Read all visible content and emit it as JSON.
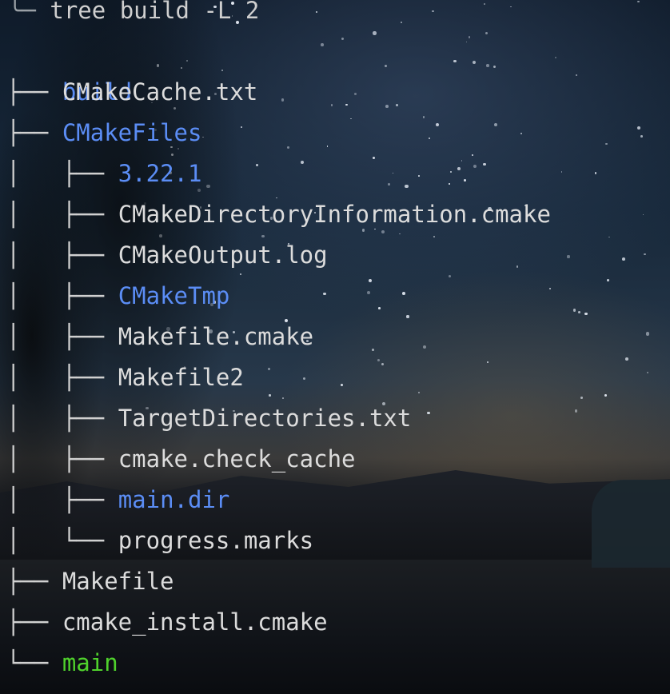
{
  "terminal": {
    "command": "tree build -L 2",
    "prompt_glyph": "╰─",
    "root": {
      "name": "build",
      "type": "dir"
    },
    "entries": [
      {
        "prefix": "├── ",
        "name": "CMakeCache.txt",
        "type": "file",
        "depth": 1
      },
      {
        "prefix": "├── ",
        "name": "CMakeFiles",
        "type": "dir",
        "depth": 1
      },
      {
        "prefix": "│   ├── ",
        "name": "3.22.1",
        "type": "dir",
        "depth": 2
      },
      {
        "prefix": "│   ├── ",
        "name": "CMakeDirectoryInformation.cmake",
        "type": "file",
        "depth": 2
      },
      {
        "prefix": "│   ├── ",
        "name": "CMakeOutput.log",
        "type": "file",
        "depth": 2
      },
      {
        "prefix": "│   ├── ",
        "name": "CMakeTmp",
        "type": "dir",
        "depth": 2
      },
      {
        "prefix": "│   ├── ",
        "name": "Makefile.cmake",
        "type": "file",
        "depth": 2
      },
      {
        "prefix": "│   ├── ",
        "name": "Makefile2",
        "type": "file",
        "depth": 2
      },
      {
        "prefix": "│   ├── ",
        "name": "TargetDirectories.txt",
        "type": "file",
        "depth": 2
      },
      {
        "prefix": "│   ├── ",
        "name": "cmake.check_cache",
        "type": "file",
        "depth": 2
      },
      {
        "prefix": "│   ├── ",
        "name": "main.dir",
        "type": "dir",
        "depth": 2
      },
      {
        "prefix": "│   └── ",
        "name": "progress.marks",
        "type": "file",
        "depth": 2
      },
      {
        "prefix": "├── ",
        "name": "Makefile",
        "type": "file",
        "depth": 1
      },
      {
        "prefix": "├── ",
        "name": "cmake_install.cmake",
        "type": "file",
        "depth": 1
      },
      {
        "prefix": "└── ",
        "name": "main",
        "type": "exec",
        "depth": 1
      }
    ]
  },
  "colors": {
    "directory": "#5b8df5",
    "executable": "#4fd12c",
    "file": "#dcdcdc"
  }
}
